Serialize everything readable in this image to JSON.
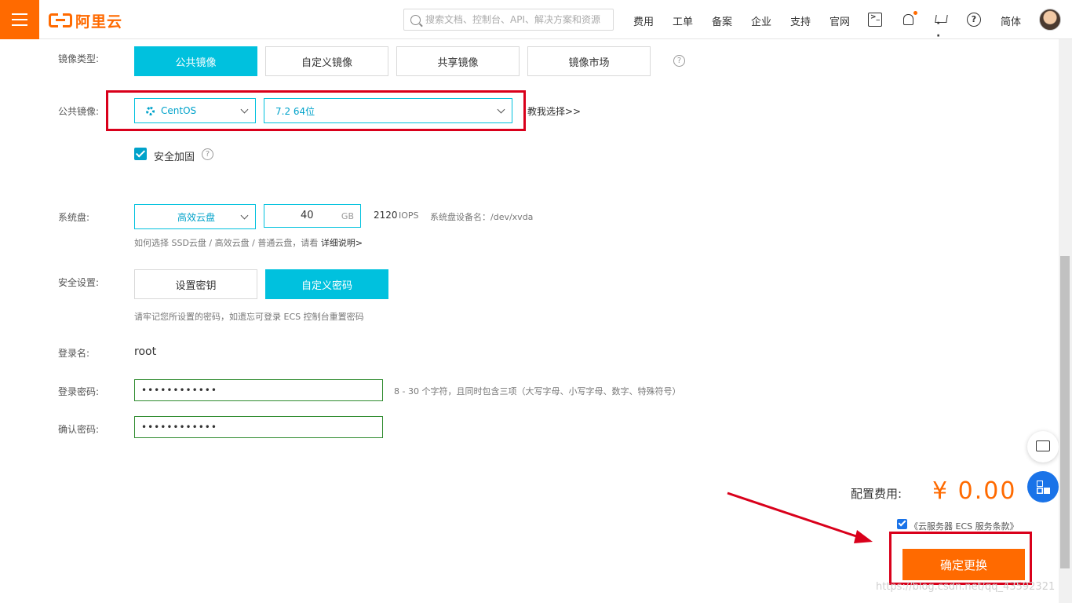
{
  "topbar": {
    "logo_text": "阿里云",
    "search_placeholder": "搜索文档、控制台、API、解决方案和资源",
    "nav": [
      "费用",
      "工单",
      "备案",
      "企业",
      "支持",
      "官网"
    ],
    "lang": "简体",
    "accent": "#ff6a00"
  },
  "image_type": {
    "label": "镜像类型:",
    "tabs": [
      "公共镜像",
      "自定义镜像",
      "共享镜像",
      "镜像市场"
    ],
    "active_index": 0
  },
  "public_image": {
    "label": "公共镜像:",
    "os": "CentOS",
    "version": "7.2 64位",
    "help_link": "教我选择>>"
  },
  "security_harden": {
    "label": "安全加固",
    "checked": true
  },
  "system_disk": {
    "label": "系统盘:",
    "type": "高效云盘",
    "size": "40",
    "unit": "GB",
    "iops_value": "2120",
    "iops_unit": "IOPS",
    "device": "系统盘设备名：/dev/xvda",
    "hint": "如何选择 SSD云盘 / 高效云盘 / 普通云盘，请看",
    "hint_link": "详细说明>"
  },
  "security_settings": {
    "label": "安全设置:",
    "options": [
      "设置密钥",
      "自定义密码"
    ],
    "active_index": 1,
    "hint": "请牢记您所设置的密码，如遗忘可登录 ECS 控制台重置密码"
  },
  "login": {
    "name_label": "登录名:",
    "name_value": "root",
    "password_label": "登录密码:",
    "password_value": "••••••••••••",
    "password_hint": "8 - 30 个字符，且同时包含三项（大写字母、小写字母、数字、特殊符号）",
    "confirm_label": "确认密码:",
    "confirm_value": "••••••••••••"
  },
  "footer": {
    "price_label": "配置费用:",
    "price_value": "¥  0.00",
    "terms_text": "《云服务器 ECS 服务条款》",
    "terms_checked": true,
    "confirm_button": "确定更换",
    "watermark": "https://blog.csdn.net/qq_43592321"
  }
}
